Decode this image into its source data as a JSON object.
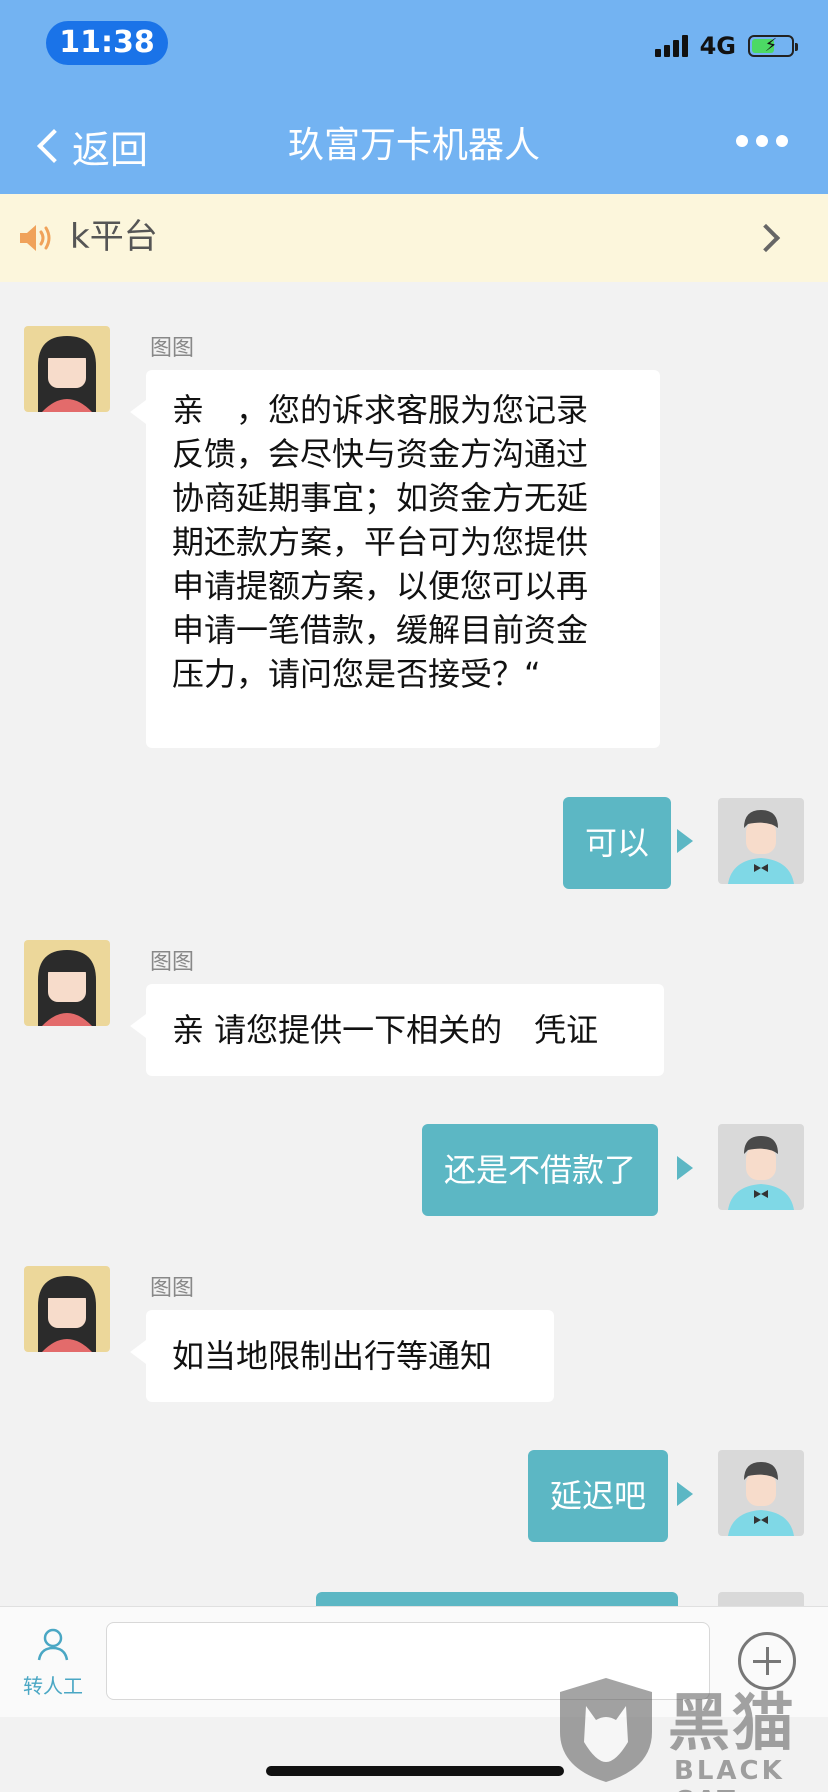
{
  "status_bar": {
    "time": "11:38",
    "network": "4G"
  },
  "nav": {
    "back_label": "返回",
    "title": "玖富万卡机器人"
  },
  "notice": {
    "text": "k平台"
  },
  "chat": {
    "bot_name": "图图",
    "messages": [
      {
        "from": "bot",
        "sender": "图图",
        "lines": [
          "亲　，您的诉求客服为您记录",
          "反馈，会尽快与资金方沟通过",
          "协商延期事宜；如资金方无延",
          "期还款方案，平台可为您提供",
          "申请提额方案，以便您可以再",
          "申请一笔借款，缓解目前资金",
          "压力，请问您是否接受？“"
        ]
      },
      {
        "from": "user",
        "text": "可以"
      },
      {
        "from": "bot",
        "sender": "图图",
        "text": "亲 请您提供一下相关的　凭证"
      },
      {
        "from": "user",
        "text": "还是不借款了"
      },
      {
        "from": "bot",
        "sender": "图图",
        "text": "如当地限制出行等通知"
      },
      {
        "from": "user",
        "text": "延迟吧"
      }
    ]
  },
  "input_bar": {
    "transfer_label": "转人工",
    "input_value": ""
  },
  "watermark": {
    "big": "黑猫",
    "small": "BLACK CAT"
  },
  "colors": {
    "nav_blue": "#73b3f2",
    "user_bubble": "#5cb7c4",
    "notice_bg": "#fcf6dc"
  }
}
